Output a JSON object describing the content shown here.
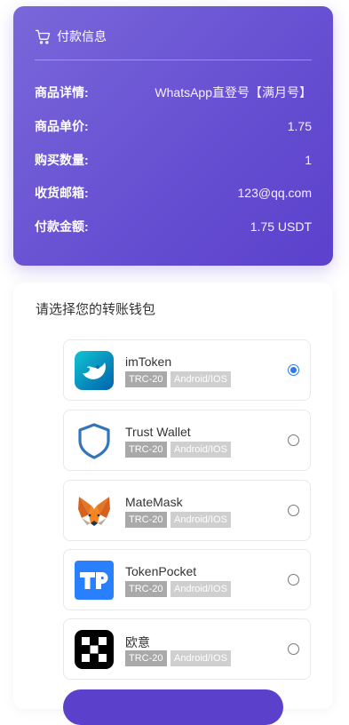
{
  "payment": {
    "title": "付款信息",
    "rows": [
      {
        "label": "商品详情:",
        "value": "WhatsApp直登号【满月号】"
      },
      {
        "label": "商品单价:",
        "value": "1.75"
      },
      {
        "label": "购买数量:",
        "value": "1"
      },
      {
        "label": "收货邮箱:",
        "value": "123@qq.com"
      },
      {
        "label": "付款金额:",
        "value": "1.75 USDT"
      }
    ]
  },
  "wallet": {
    "title": "请选择您的转账钱包",
    "selected_index": 0,
    "items": [
      {
        "name": "imToken",
        "tag1": "TRC-20",
        "tag2": "Android/IOS",
        "icon": "imtoken-icon"
      },
      {
        "name": "Trust Wallet",
        "tag1": "TRC-20",
        "tag2": "Android/IOS",
        "icon": "trust-wallet-shield-icon"
      },
      {
        "name": "MateMask",
        "tag1": "TRC-20",
        "tag2": "Android/IOS",
        "icon": "metamask-fox-icon"
      },
      {
        "name": "TokenPocket",
        "tag1": "TRC-20",
        "tag2": "Android/IOS",
        "icon": "tokenpocket-icon"
      },
      {
        "name": "欧意",
        "tag1": "TRC-20",
        "tag2": "Android/IOS",
        "icon": "okx-icon"
      }
    ]
  },
  "colors": {
    "card_gradient_start": "#7a67da",
    "card_gradient_end": "#5b41cc",
    "radio_selected": "#2d7be5",
    "button": "#5b40cc"
  }
}
